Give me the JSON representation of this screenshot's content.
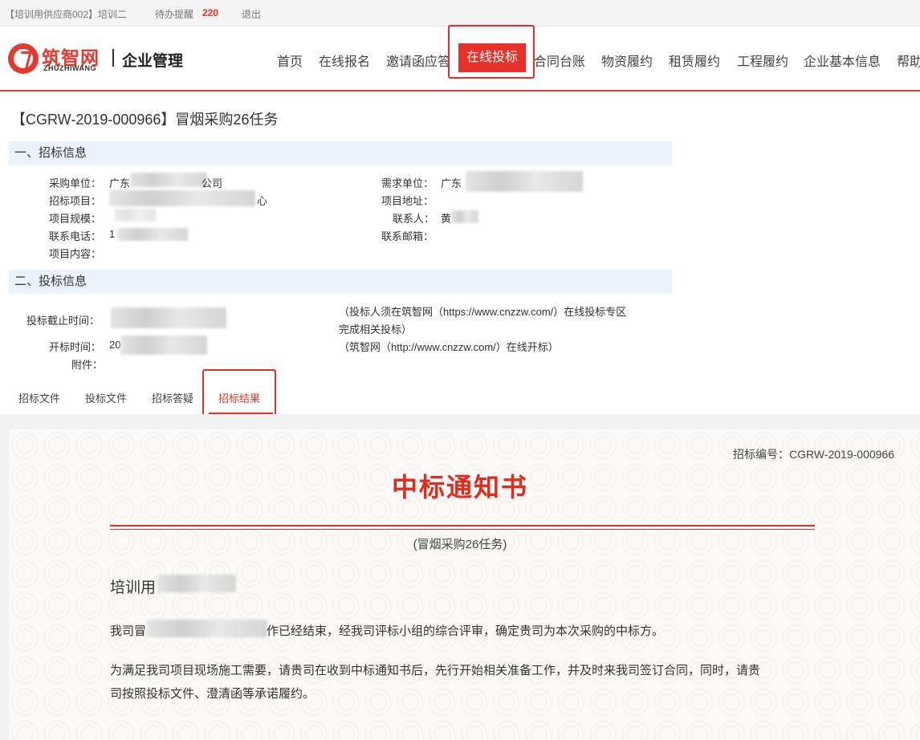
{
  "topbar": {
    "user": "【培训用供应商002】培训二",
    "reminder_label": "待办提醒",
    "reminder_count": "220",
    "logout": "退出"
  },
  "brand": {
    "name_cn": "筑智网",
    "name_en": "ZHUZHIWANG",
    "subtitle": "企业管理",
    "color": "#e33a2f"
  },
  "nav": {
    "items": [
      "首页",
      "在线报名",
      "邀请函应答",
      "在线投标",
      "合同台账",
      "物资履约",
      "租赁履约",
      "工程履约",
      "企业基本信息",
      "帮助"
    ],
    "active": "在线投标"
  },
  "page": {
    "title": "【CGRW-2019-000966】冒烟采购26任务"
  },
  "section1": {
    "heading": "一、招标信息",
    "fields": {
      "buyer_label": "采购单位：",
      "buyer_value_start": "广东",
      "buyer_value_end": "公司",
      "demand_label": "需求单位：",
      "demand_value_start": "广东",
      "project_label": "招标项目：",
      "project_value_end": "心",
      "address_label": "项目地址：",
      "scale_label": "项目规模：",
      "contact_label": "联系人：",
      "contact_value_start": "黄",
      "phone_label": "联系电话：",
      "phone_value_start": "1",
      "email_label": "联系邮箱：",
      "content_label": "项目内容："
    }
  },
  "section2": {
    "heading": "二、投标信息",
    "deadline_label": "投标截止时间：",
    "open_label": "开标时间：",
    "open_value_start": "20",
    "attach_label": "附件：",
    "note1_line1": "（投标人须在筑智网（https://www.cnzzw.com/）在线投标专区",
    "note1_line2": "完成相关投标）",
    "note2": "（筑智网（http://www.cnzzw.com/）在线开标）"
  },
  "tabs": [
    "招标文件",
    "投标文件",
    "招标答疑",
    "招标结果"
  ],
  "active_tab": "招标结果",
  "notice": {
    "number": "招标编号：CGRW-2019-000966",
    "title": "中标通知书",
    "subtitle": "(冒烟采购26任务)",
    "greeting": "培训用",
    "para1_start": "我司冒",
    "para1_end": "作已经结束，经我司评标小组的综合评审，确定贵司为本次采购的中标方。",
    "para2_line1": "为满足我司项目现场施工需要，请贵司在收到中标通知书后，先行开始相关准备工作，并及时来我司签订合同，同时，请贵",
    "para2_line2": "司按照投标文件、澄清函等承诺履约。"
  },
  "colors": {
    "accent": "#e8312a",
    "section_bg": "#eaf2fb",
    "notice_title": "#e02c1d"
  }
}
